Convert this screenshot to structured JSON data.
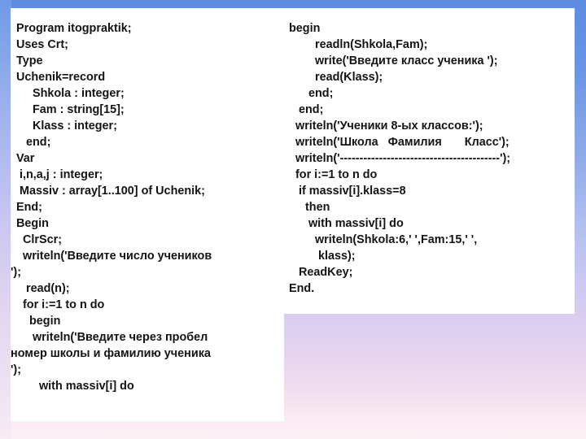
{
  "slide": {
    "background": {
      "top_color": "#5d8ce2",
      "bottom_color": "#fdf1f6"
    },
    "panel_background": "#ffffff",
    "text_color": "#141414"
  },
  "left_panel": {
    "title": "pascal-source-part-1",
    "lines": [
      "Program itogpraktik;",
      "Uses Crt;",
      "Type",
      "Uchenik=record",
      "     Shkola : integer;",
      "     Fam : string[15];",
      "     Klass : integer;",
      "   end;",
      "Var",
      " i,n,a,j : integer;",
      " Massiv : array[1..100] of Uchenik;",
      "End;",
      "Begin",
      "  ClrScr;",
      "  writeln('Введите число учеников",
      "');",
      "   read(n);",
      "  for i:=1 to n do",
      "    begin",
      "     writeln('Введите через пробел",
      "номер школы и фамилию ученика",
      "');",
      "       with massiv[i] do"
    ],
    "flush_line_indexes": [
      15,
      20,
      21
    ]
  },
  "right_panel": {
    "title": "pascal-source-part-2",
    "lines": [
      "begin",
      "        readln(Shkola,Fam);",
      "        write('Введите класс ученика ');",
      "        read(Klass);",
      "      end;",
      "   end;",
      "  writeln('Ученики 8-ых классов:');",
      "  writeln('Школа   Фамилия       Класс');",
      "  writeln('-----------------------------------------');",
      "  for i:=1 to n do",
      "   if massiv[i].klass=8",
      "     then",
      "      with massiv[i] do",
      "        writeln(Shkola:6,' ',Fam:15,' ',",
      "         klass);",
      "   ReadKey;",
      "End."
    ]
  }
}
